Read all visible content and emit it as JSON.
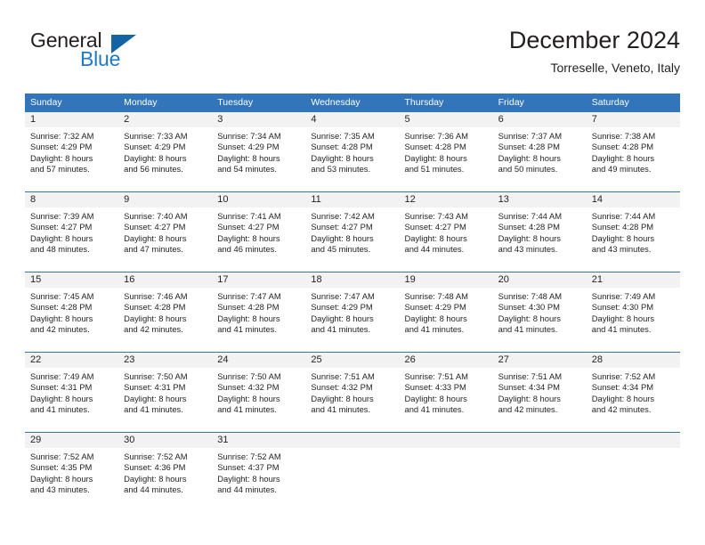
{
  "logo": {
    "text_top": "General",
    "text_bottom": "Blue",
    "triangle": "blue-triangle-icon",
    "color_dark": "#231f20",
    "color_blue": "#1f7ac4",
    "color_triangle": "#1464a5"
  },
  "header": {
    "title": "December 2024",
    "subtitle": "Torreselle, Veneto, Italy"
  },
  "theme": {
    "header_blue": "#3275bb",
    "date_band_gray": "#f2f2f2",
    "text": "#231f20"
  },
  "calendar": {
    "weekday_headers": [
      "Sunday",
      "Monday",
      "Tuesday",
      "Wednesday",
      "Thursday",
      "Friday",
      "Saturday"
    ],
    "weeks": [
      [
        {
          "day": "1",
          "sunrise": "Sunrise: 7:32 AM",
          "sunset": "Sunset: 4:29 PM",
          "daylight1": "Daylight: 8 hours",
          "daylight2": "and 57 minutes."
        },
        {
          "day": "2",
          "sunrise": "Sunrise: 7:33 AM",
          "sunset": "Sunset: 4:29 PM",
          "daylight1": "Daylight: 8 hours",
          "daylight2": "and 56 minutes."
        },
        {
          "day": "3",
          "sunrise": "Sunrise: 7:34 AM",
          "sunset": "Sunset: 4:29 PM",
          "daylight1": "Daylight: 8 hours",
          "daylight2": "and 54 minutes."
        },
        {
          "day": "4",
          "sunrise": "Sunrise: 7:35 AM",
          "sunset": "Sunset: 4:28 PM",
          "daylight1": "Daylight: 8 hours",
          "daylight2": "and 53 minutes."
        },
        {
          "day": "5",
          "sunrise": "Sunrise: 7:36 AM",
          "sunset": "Sunset: 4:28 PM",
          "daylight1": "Daylight: 8 hours",
          "daylight2": "and 51 minutes."
        },
        {
          "day": "6",
          "sunrise": "Sunrise: 7:37 AM",
          "sunset": "Sunset: 4:28 PM",
          "daylight1": "Daylight: 8 hours",
          "daylight2": "and 50 minutes."
        },
        {
          "day": "7",
          "sunrise": "Sunrise: 7:38 AM",
          "sunset": "Sunset: 4:28 PM",
          "daylight1": "Daylight: 8 hours",
          "daylight2": "and 49 minutes."
        }
      ],
      [
        {
          "day": "8",
          "sunrise": "Sunrise: 7:39 AM",
          "sunset": "Sunset: 4:27 PM",
          "daylight1": "Daylight: 8 hours",
          "daylight2": "and 48 minutes."
        },
        {
          "day": "9",
          "sunrise": "Sunrise: 7:40 AM",
          "sunset": "Sunset: 4:27 PM",
          "daylight1": "Daylight: 8 hours",
          "daylight2": "and 47 minutes."
        },
        {
          "day": "10",
          "sunrise": "Sunrise: 7:41 AM",
          "sunset": "Sunset: 4:27 PM",
          "daylight1": "Daylight: 8 hours",
          "daylight2": "and 46 minutes."
        },
        {
          "day": "11",
          "sunrise": "Sunrise: 7:42 AM",
          "sunset": "Sunset: 4:27 PM",
          "daylight1": "Daylight: 8 hours",
          "daylight2": "and 45 minutes."
        },
        {
          "day": "12",
          "sunrise": "Sunrise: 7:43 AM",
          "sunset": "Sunset: 4:27 PM",
          "daylight1": "Daylight: 8 hours",
          "daylight2": "and 44 minutes."
        },
        {
          "day": "13",
          "sunrise": "Sunrise: 7:44 AM",
          "sunset": "Sunset: 4:28 PM",
          "daylight1": "Daylight: 8 hours",
          "daylight2": "and 43 minutes."
        },
        {
          "day": "14",
          "sunrise": "Sunrise: 7:44 AM",
          "sunset": "Sunset: 4:28 PM",
          "daylight1": "Daylight: 8 hours",
          "daylight2": "and 43 minutes."
        }
      ],
      [
        {
          "day": "15",
          "sunrise": "Sunrise: 7:45 AM",
          "sunset": "Sunset: 4:28 PM",
          "daylight1": "Daylight: 8 hours",
          "daylight2": "and 42 minutes."
        },
        {
          "day": "16",
          "sunrise": "Sunrise: 7:46 AM",
          "sunset": "Sunset: 4:28 PM",
          "daylight1": "Daylight: 8 hours",
          "daylight2": "and 42 minutes."
        },
        {
          "day": "17",
          "sunrise": "Sunrise: 7:47 AM",
          "sunset": "Sunset: 4:28 PM",
          "daylight1": "Daylight: 8 hours",
          "daylight2": "and 41 minutes."
        },
        {
          "day": "18",
          "sunrise": "Sunrise: 7:47 AM",
          "sunset": "Sunset: 4:29 PM",
          "daylight1": "Daylight: 8 hours",
          "daylight2": "and 41 minutes."
        },
        {
          "day": "19",
          "sunrise": "Sunrise: 7:48 AM",
          "sunset": "Sunset: 4:29 PM",
          "daylight1": "Daylight: 8 hours",
          "daylight2": "and 41 minutes."
        },
        {
          "day": "20",
          "sunrise": "Sunrise: 7:48 AM",
          "sunset": "Sunset: 4:30 PM",
          "daylight1": "Daylight: 8 hours",
          "daylight2": "and 41 minutes."
        },
        {
          "day": "21",
          "sunrise": "Sunrise: 7:49 AM",
          "sunset": "Sunset: 4:30 PM",
          "daylight1": "Daylight: 8 hours",
          "daylight2": "and 41 minutes."
        }
      ],
      [
        {
          "day": "22",
          "sunrise": "Sunrise: 7:49 AM",
          "sunset": "Sunset: 4:31 PM",
          "daylight1": "Daylight: 8 hours",
          "daylight2": "and 41 minutes."
        },
        {
          "day": "23",
          "sunrise": "Sunrise: 7:50 AM",
          "sunset": "Sunset: 4:31 PM",
          "daylight1": "Daylight: 8 hours",
          "daylight2": "and 41 minutes."
        },
        {
          "day": "24",
          "sunrise": "Sunrise: 7:50 AM",
          "sunset": "Sunset: 4:32 PM",
          "daylight1": "Daylight: 8 hours",
          "daylight2": "and 41 minutes."
        },
        {
          "day": "25",
          "sunrise": "Sunrise: 7:51 AM",
          "sunset": "Sunset: 4:32 PM",
          "daylight1": "Daylight: 8 hours",
          "daylight2": "and 41 minutes."
        },
        {
          "day": "26",
          "sunrise": "Sunrise: 7:51 AM",
          "sunset": "Sunset: 4:33 PM",
          "daylight1": "Daylight: 8 hours",
          "daylight2": "and 41 minutes."
        },
        {
          "day": "27",
          "sunrise": "Sunrise: 7:51 AM",
          "sunset": "Sunset: 4:34 PM",
          "daylight1": "Daylight: 8 hours",
          "daylight2": "and 42 minutes."
        },
        {
          "day": "28",
          "sunrise": "Sunrise: 7:52 AM",
          "sunset": "Sunset: 4:34 PM",
          "daylight1": "Daylight: 8 hours",
          "daylight2": "and 42 minutes."
        }
      ],
      [
        {
          "day": "29",
          "sunrise": "Sunrise: 7:52 AM",
          "sunset": "Sunset: 4:35 PM",
          "daylight1": "Daylight: 8 hours",
          "daylight2": "and 43 minutes."
        },
        {
          "day": "30",
          "sunrise": "Sunrise: 7:52 AM",
          "sunset": "Sunset: 4:36 PM",
          "daylight1": "Daylight: 8 hours",
          "daylight2": "and 44 minutes."
        },
        {
          "day": "31",
          "sunrise": "Sunrise: 7:52 AM",
          "sunset": "Sunset: 4:37 PM",
          "daylight1": "Daylight: 8 hours",
          "daylight2": "and 44 minutes."
        },
        {
          "day": "",
          "sunrise": "",
          "sunset": "",
          "daylight1": "",
          "daylight2": ""
        },
        {
          "day": "",
          "sunrise": "",
          "sunset": "",
          "daylight1": "",
          "daylight2": ""
        },
        {
          "day": "",
          "sunrise": "",
          "sunset": "",
          "daylight1": "",
          "daylight2": ""
        },
        {
          "day": "",
          "sunrise": "",
          "sunset": "",
          "daylight1": "",
          "daylight2": ""
        }
      ]
    ]
  }
}
